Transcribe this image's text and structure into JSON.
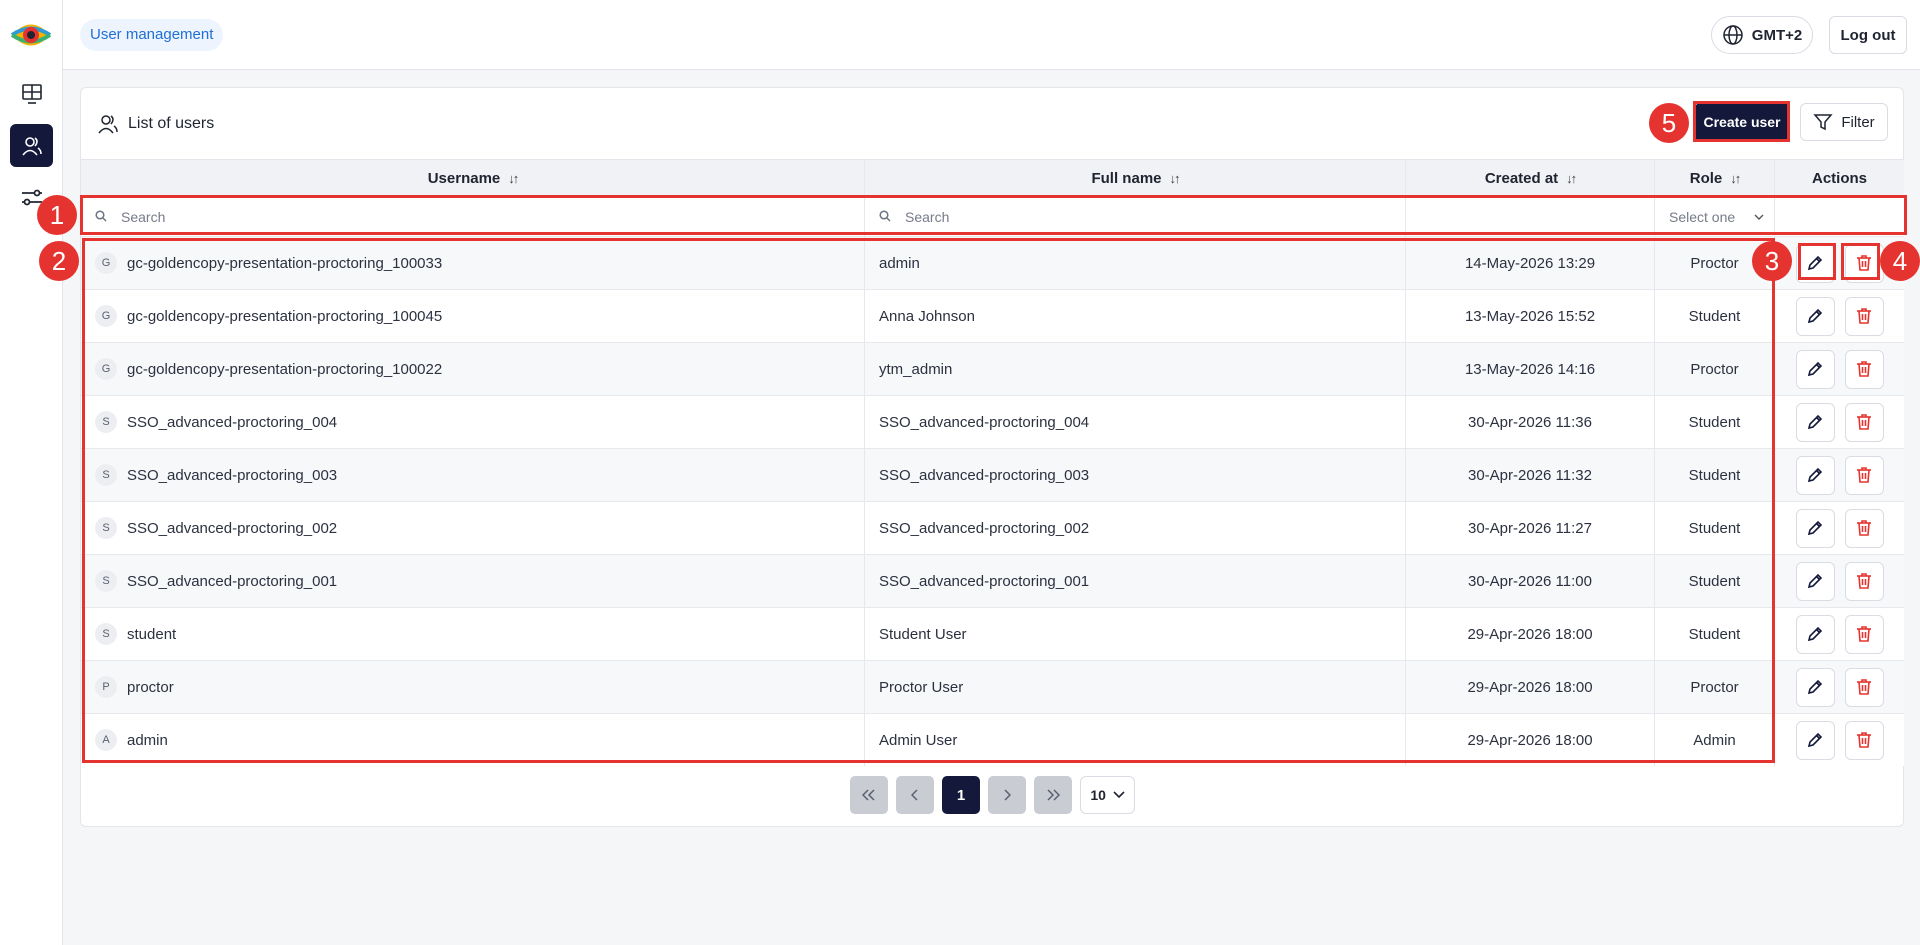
{
  "header": {
    "breadcrumb": "User management",
    "timezone": "GMT+2",
    "logout_label": "Log out"
  },
  "sidebar": {
    "items": [
      {
        "icon": "monitor-grid-icon",
        "active": false
      },
      {
        "icon": "users-icon",
        "active": true
      },
      {
        "icon": "settings-sliders-icon",
        "active": false
      }
    ]
  },
  "card": {
    "title": "List of users",
    "create_label": "Create user",
    "filter_label": "Filter"
  },
  "table": {
    "columns": {
      "username": "Username",
      "full_name": "Full name",
      "created_at": "Created at",
      "role": "Role",
      "actions": "Actions"
    },
    "filters": {
      "username_placeholder": "Search",
      "full_name_placeholder": "Search",
      "role_placeholder": "Select one"
    },
    "rows": [
      {
        "initial": "G",
        "username": "gc-goldencopy-presentation-proctoring_100033",
        "full_name": "admin",
        "created_at": "14-May-2026 13:29",
        "role": "Proctor"
      },
      {
        "initial": "G",
        "username": "gc-goldencopy-presentation-proctoring_100045",
        "full_name": "Anna Johnson",
        "created_at": "13-May-2026 15:52",
        "role": "Student"
      },
      {
        "initial": "G",
        "username": "gc-goldencopy-presentation-proctoring_100022",
        "full_name": "ytm_admin",
        "created_at": "13-May-2026 14:16",
        "role": "Proctor"
      },
      {
        "initial": "S",
        "username": "SSO_advanced-proctoring_004",
        "full_name": "SSO_advanced-proctoring_004",
        "created_at": "30-Apr-2026 11:36",
        "role": "Student"
      },
      {
        "initial": "S",
        "username": "SSO_advanced-proctoring_003",
        "full_name": "SSO_advanced-proctoring_003",
        "created_at": "30-Apr-2026 11:32",
        "role": "Student"
      },
      {
        "initial": "S",
        "username": "SSO_advanced-proctoring_002",
        "full_name": "SSO_advanced-proctoring_002",
        "created_at": "30-Apr-2026 11:27",
        "role": "Student"
      },
      {
        "initial": "S",
        "username": "SSO_advanced-proctoring_001",
        "full_name": "SSO_advanced-proctoring_001",
        "created_at": "30-Apr-2026 11:00",
        "role": "Student"
      },
      {
        "initial": "S",
        "username": "student",
        "full_name": "Student User",
        "created_at": "29-Apr-2026 18:00",
        "role": "Student"
      },
      {
        "initial": "P",
        "username": "proctor",
        "full_name": "Proctor User",
        "created_at": "29-Apr-2026 18:00",
        "role": "Proctor"
      },
      {
        "initial": "A",
        "username": "admin",
        "full_name": "Admin User",
        "created_at": "29-Apr-2026 18:00",
        "role": "Admin"
      }
    ]
  },
  "pagination": {
    "current_page": "1",
    "page_size": "10"
  },
  "annotations": {
    "labels": [
      "1",
      "2",
      "3",
      "4",
      "5"
    ],
    "color": "#e5342f"
  },
  "colors": {
    "primary": "#14193b",
    "accent": "#1e6fd9",
    "danger": "#e5342f"
  }
}
